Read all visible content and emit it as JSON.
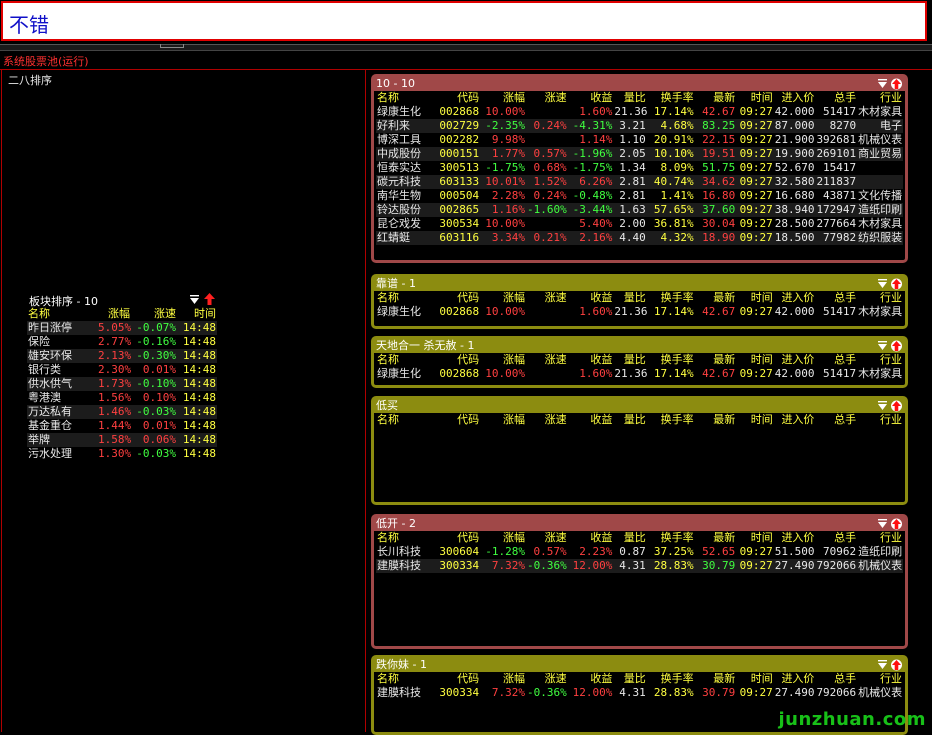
{
  "header": {
    "title": "不错"
  },
  "pool": {
    "title": "系统股票池(运行)",
    "sort_title": "二八排序"
  },
  "colors": {
    "up": "#ff4040",
    "down": "#40ff40",
    "header_yellow": "#ffff40",
    "panel_red": "#a04848",
    "panel_olive": "#8c8c10",
    "watermark": "#18c018"
  },
  "icons": {
    "sort": "sort-triangle-icon",
    "arrow": "red-up-arrow-icon"
  },
  "sector": {
    "title": "板块排序 - 10",
    "columns": [
      "名称",
      "涨幅",
      "涨速",
      "时间"
    ],
    "rows": [
      [
        "昨日涨停",
        "5.05%",
        "-0.07%",
        "14:48"
      ],
      [
        "保险",
        "2.77%",
        "-0.16%",
        "14:48"
      ],
      [
        "雄安环保",
        "2.13%",
        "-0.30%",
        "14:48"
      ],
      [
        "银行类",
        "2.30%",
        "0.01%",
        "14:48"
      ],
      [
        "供水供气",
        "1.73%",
        "-0.10%",
        "14:48"
      ],
      [
        "粤港澳",
        "1.56%",
        "0.10%",
        "14:48"
      ],
      [
        "万达私有",
        "1.46%",
        "-0.03%",
        "14:48"
      ],
      [
        "基金重仓",
        "1.44%",
        "0.01%",
        "14:48"
      ],
      [
        "举牌",
        "1.58%",
        "0.06%",
        "14:48"
      ],
      [
        "污水处理",
        "1.30%",
        "-0.03%",
        "14:48"
      ]
    ]
  },
  "stock_columns": [
    "名称",
    "代码",
    "涨幅",
    "涨速",
    "收益",
    "量比",
    "换手率",
    "最新",
    "时间",
    "进入价",
    "总手",
    "行业"
  ],
  "panels": [
    {
      "title": "10 - 10",
      "rows": [
        [
          "绿康生化",
          "002868",
          "10.00%",
          "",
          "1.60%",
          "21.36",
          "17.14%",
          "42.67",
          "09:27",
          "42.000",
          "51417",
          "木材家具"
        ],
        [
          "好利来",
          "002729",
          "-2.35%",
          "0.24%",
          "-4.31%",
          "3.21",
          "4.68%",
          "83.25",
          "09:27",
          "87.000",
          "8270",
          "电子"
        ],
        [
          "博深工具",
          "002282",
          "9.98%",
          "",
          "1.14%",
          "1.10",
          "20.91%",
          "22.15",
          "09:27",
          "21.900",
          "392681",
          "机械仪表"
        ],
        [
          "中成股份",
          "000151",
          "1.77%",
          "0.57%",
          "-1.96%",
          "2.05",
          "10.10%",
          "19.51",
          "09:27",
          "19.900",
          "269101",
          "商业贸易"
        ],
        [
          "恒泰实达",
          "300513",
          "-1.75%",
          "0.68%",
          "-1.75%",
          "1.34",
          "8.09%",
          "51.75",
          "09:27",
          "52.670",
          "15417",
          ""
        ],
        [
          "碳元科技",
          "603133",
          "10.01%",
          "1.52%",
          "6.26%",
          "2.81",
          "40.74%",
          "34.62",
          "09:27",
          "32.580",
          "211837",
          ""
        ],
        [
          "南华生物",
          "000504",
          "2.28%",
          "0.24%",
          "-0.48%",
          "2.81",
          "1.41%",
          "16.80",
          "09:27",
          "16.680",
          "43871",
          "文化传播"
        ],
        [
          "铃达股份",
          "002865",
          "1.16%",
          "-1.60%",
          "-3.44%",
          "1.63",
          "57.65%",
          "37.60",
          "09:27",
          "38.940",
          "172947",
          "造纸印刷"
        ],
        [
          "昆仑戏发",
          "300534",
          "10.00%",
          "",
          "5.40%",
          "2.00",
          "36.81%",
          "30.04",
          "09:27",
          "28.500",
          "277664",
          "木材家具"
        ],
        [
          "红蜻蜓",
          "603116",
          "3.34%",
          "0.21%",
          "2.16%",
          "4.40",
          "4.32%",
          "18.90",
          "09:27",
          "18.500",
          "77982",
          "纺织服装"
        ]
      ]
    },
    {
      "title": "靠谱 - 1",
      "rows": [
        [
          "绿康生化",
          "002868",
          "10.00%",
          "",
          "1.60%",
          "21.36",
          "17.14%",
          "42.67",
          "09:27",
          "42.000",
          "51417",
          "木材家具"
        ]
      ]
    },
    {
      "title": "天地合一 杀无赦 - 1",
      "rows": [
        [
          "绿康生化",
          "002868",
          "10.00%",
          "",
          "1.60%",
          "21.36",
          "17.14%",
          "42.67",
          "09:27",
          "42.000",
          "51417",
          "木材家具"
        ]
      ]
    },
    {
      "title": "低买",
      "rows": []
    },
    {
      "title": "低开 - 2",
      "rows": [
        [
          "长川科技",
          "300604",
          "-1.28%",
          "0.57%",
          "2.23%",
          "0.87",
          "37.25%",
          "52.65",
          "09:27",
          "51.500",
          "70962",
          "造纸印刷"
        ],
        [
          "建膜科技",
          "300334",
          "7.32%",
          "-0.36%",
          "12.00%",
          "4.31",
          "28.83%",
          "30.79",
          "09:27",
          "27.490",
          "792066",
          "机械仪表"
        ]
      ]
    },
    {
      "title": "跌你妹 - 1",
      "rows": [
        [
          "建膜科技",
          "300334",
          "7.32%",
          "-0.36%",
          "12.00%",
          "4.31",
          "28.83%",
          "30.79",
          "09:27",
          "27.490",
          "792066",
          "机械仪表"
        ]
      ]
    }
  ],
  "watermark": "junzhuan.com"
}
